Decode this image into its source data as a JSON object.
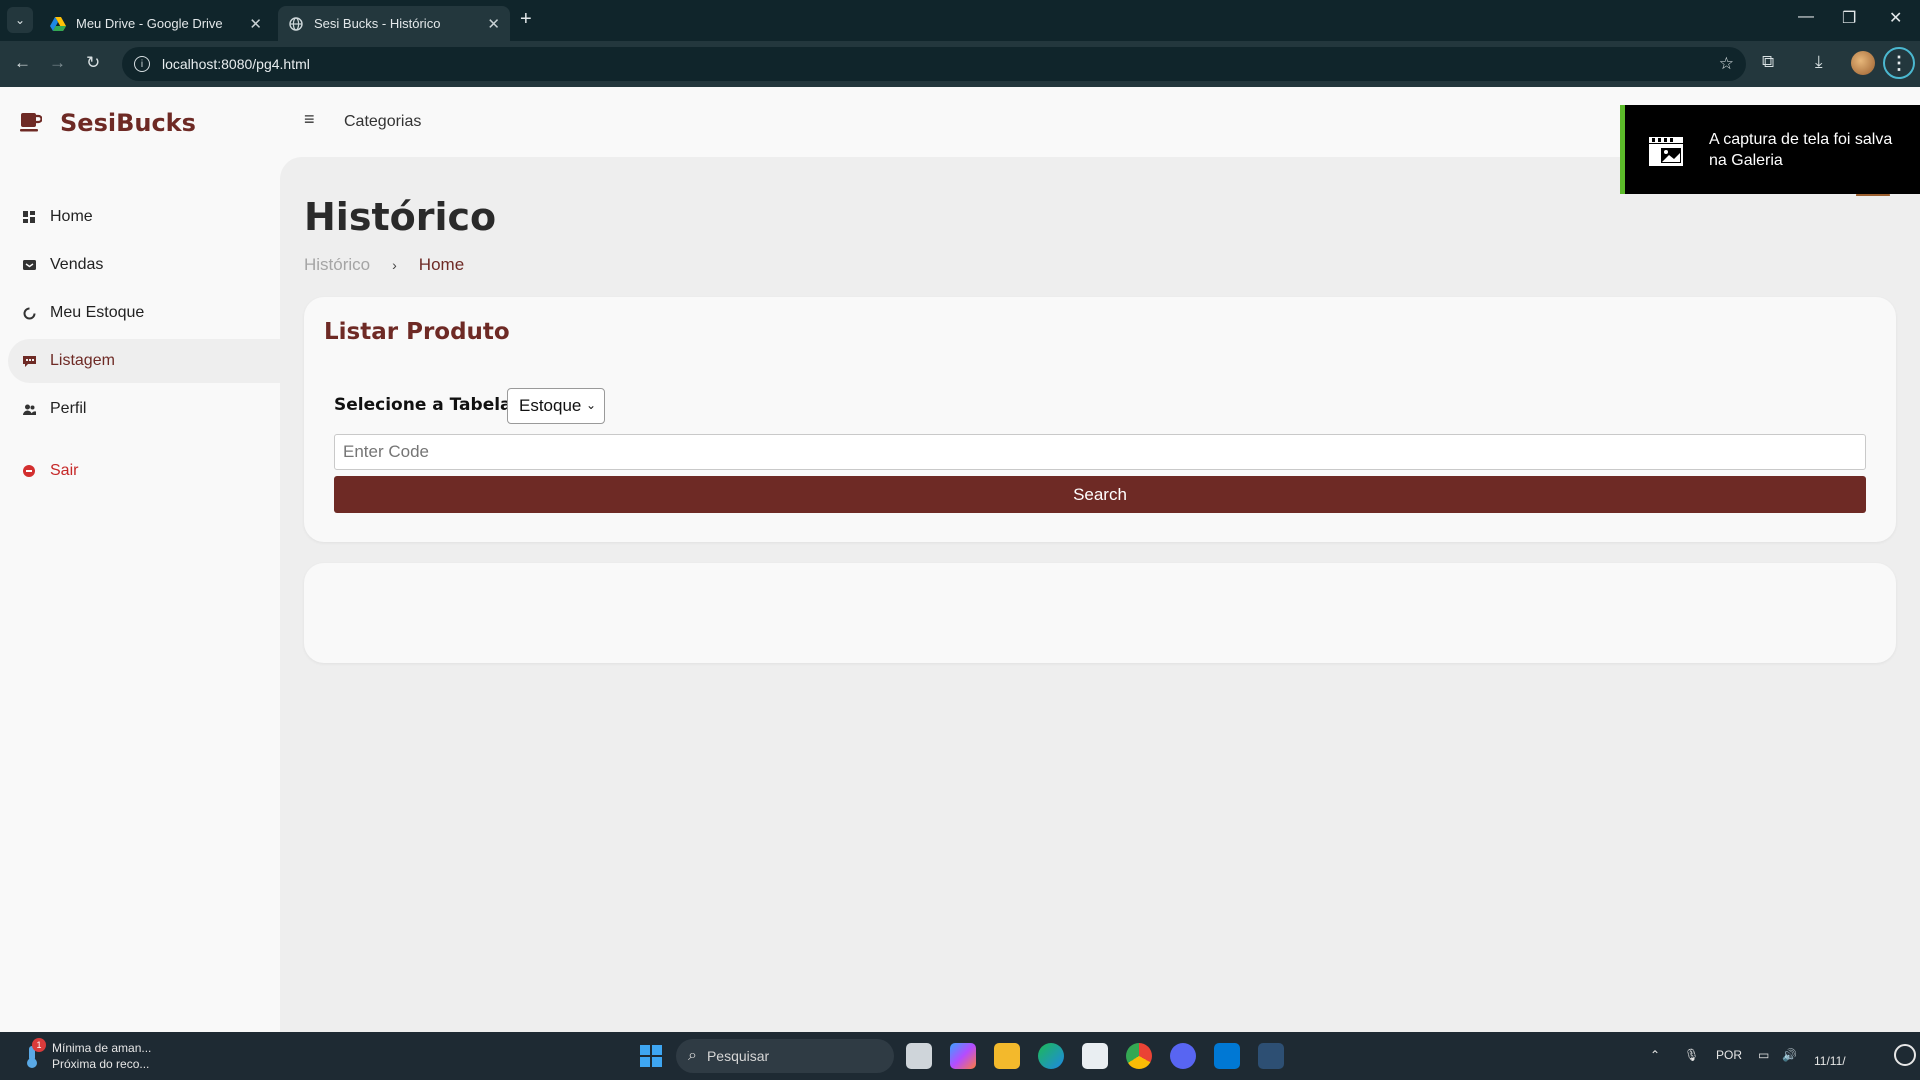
{
  "browser": {
    "tabs": [
      {
        "title": "Meu Drive - Google Drive",
        "close": "✕"
      },
      {
        "title": "Sesi Bucks - Histórico",
        "close": "✕"
      }
    ],
    "new_tab": "+",
    "url": "localhost:8080/pg4.html",
    "window_controls": {
      "minimize": "—",
      "restore": "❐",
      "close": "✕"
    }
  },
  "app": {
    "brand": "SesiBucks",
    "menu": [
      {
        "label": "Home",
        "icon": "dashboard-icon"
      },
      {
        "label": "Vendas",
        "icon": "cart-icon"
      },
      {
        "label": "Meu Estoque",
        "icon": "loader-icon"
      },
      {
        "label": "Listagem",
        "icon": "message-icon",
        "active": true
      },
      {
        "label": "Perfil",
        "icon": "users-icon"
      }
    ],
    "logout": "Sair",
    "topnav_link": "Categorias"
  },
  "main": {
    "title": "Histórico",
    "breadcrumb": [
      "Histórico",
      "Home"
    ],
    "breadcrumb_sep": "›",
    "card": {
      "title": "Listar Produto",
      "select_label": "Selecione a Tabela:",
      "select_value": "Estoque",
      "input_placeholder": "Enter Code",
      "button": "Search"
    }
  },
  "toast": {
    "text": "A captura de tela foi salva na Galeria"
  },
  "taskbar": {
    "weather_title": "Mínima de aman...",
    "weather_sub": "Próxima do reco...",
    "weather_badge": "1",
    "search_placeholder": "Pesquisar",
    "lang": "POR",
    "date": "11/11/"
  },
  "colors": {
    "accent": "#6e2a25",
    "logout": "#c62828",
    "toast_bar": "#5cbb2a"
  }
}
